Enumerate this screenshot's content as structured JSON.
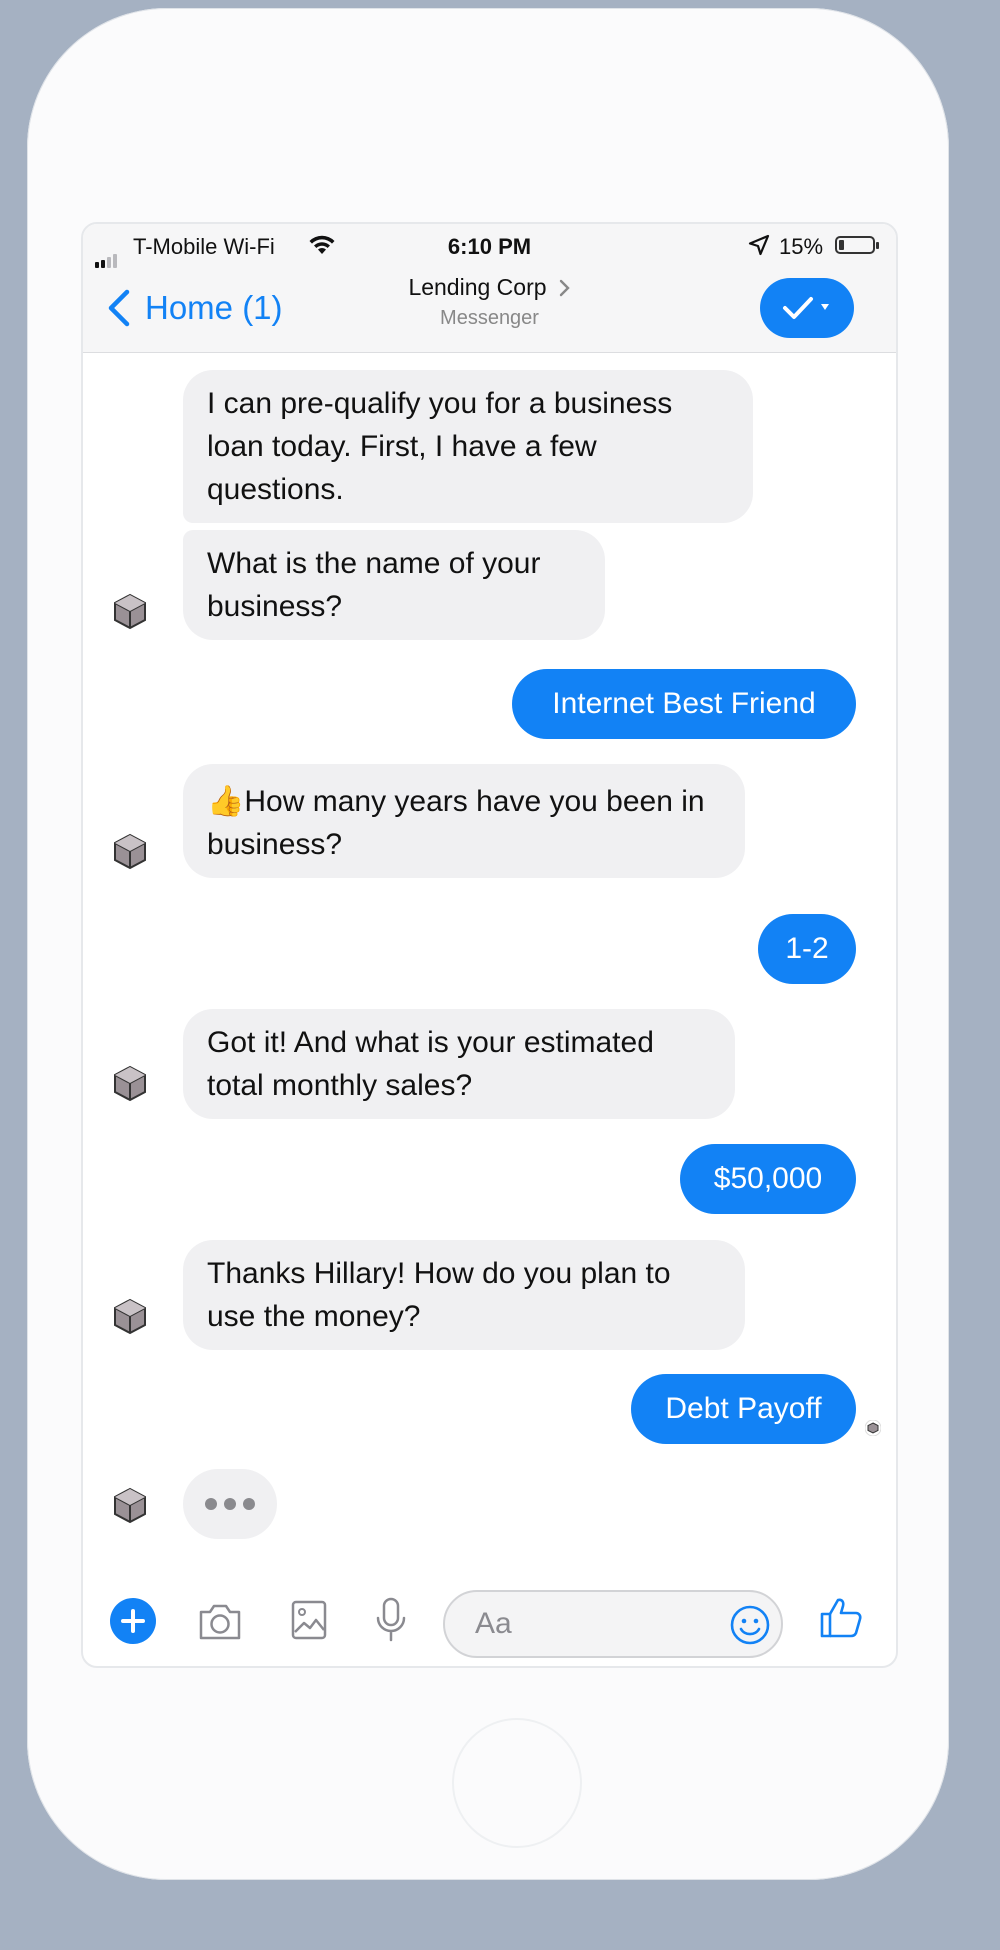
{
  "status_bar": {
    "carrier": "T-Mobile Wi-Fi",
    "time": "6:10 PM",
    "battery": "15%",
    "battery_level": 0.15,
    "signal_bars": 2
  },
  "nav": {
    "back_label": "Home (1)",
    "title": "Lending Corp",
    "subtitle": "Messenger"
  },
  "messages": [
    {
      "from": "bot",
      "text": "I can pre-qualify you for a business loan today. First, I have a few questions."
    },
    {
      "from": "bot",
      "text": "What is the name of your business?"
    },
    {
      "from": "user",
      "text": "Internet Best Friend"
    },
    {
      "from": "bot",
      "text": "👍How many years have you been in business?"
    },
    {
      "from": "user",
      "text": "1-2"
    },
    {
      "from": "bot",
      "text": "Got it! And what is your estimated total monthly sales?"
    },
    {
      "from": "user",
      "text": "$50,000"
    },
    {
      "from": "bot",
      "text": "Thanks Hillary! How do you plan to use the money?"
    },
    {
      "from": "user",
      "text": "Debt Payoff"
    }
  ],
  "composer": {
    "placeholder": "Aa"
  },
  "colors": {
    "accent": "#1282f5",
    "incoming_bubble": "#f0f0f2",
    "background": "#a5b1c2"
  },
  "icons": [
    "signal-icon",
    "wifi-icon",
    "location-arrow-icon",
    "battery-icon",
    "chevron-left-icon",
    "chevron-right-icon",
    "checkmark-icon",
    "caret-down-icon",
    "bot-avatar-icon",
    "plus-icon",
    "camera-icon",
    "image-icon",
    "microphone-icon",
    "smiley-icon",
    "thumbs-up-icon"
  ]
}
